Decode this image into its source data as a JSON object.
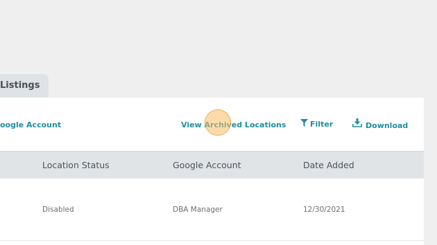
{
  "tab": {
    "label": "Listings"
  },
  "toolbar": {
    "google_account_label": "oogle Account",
    "view_archived_label": "View Archived Locations",
    "filter_label": "Filter",
    "download_label": "Download"
  },
  "table": {
    "headers": [
      "Location Status",
      "Google Account",
      "Date Added"
    ],
    "rows": [
      {
        "location_status": "Disabled",
        "google_account": "DBA Manager",
        "date_added": "12/30/2021"
      }
    ]
  },
  "colors": {
    "accent": "#1f8ea0",
    "header_bg": "#e0e4e7",
    "page_bg": "#efefef",
    "click_indicator": "#fbbe64"
  },
  "icons": {
    "filter": "filter-icon",
    "download": "download-icon"
  }
}
